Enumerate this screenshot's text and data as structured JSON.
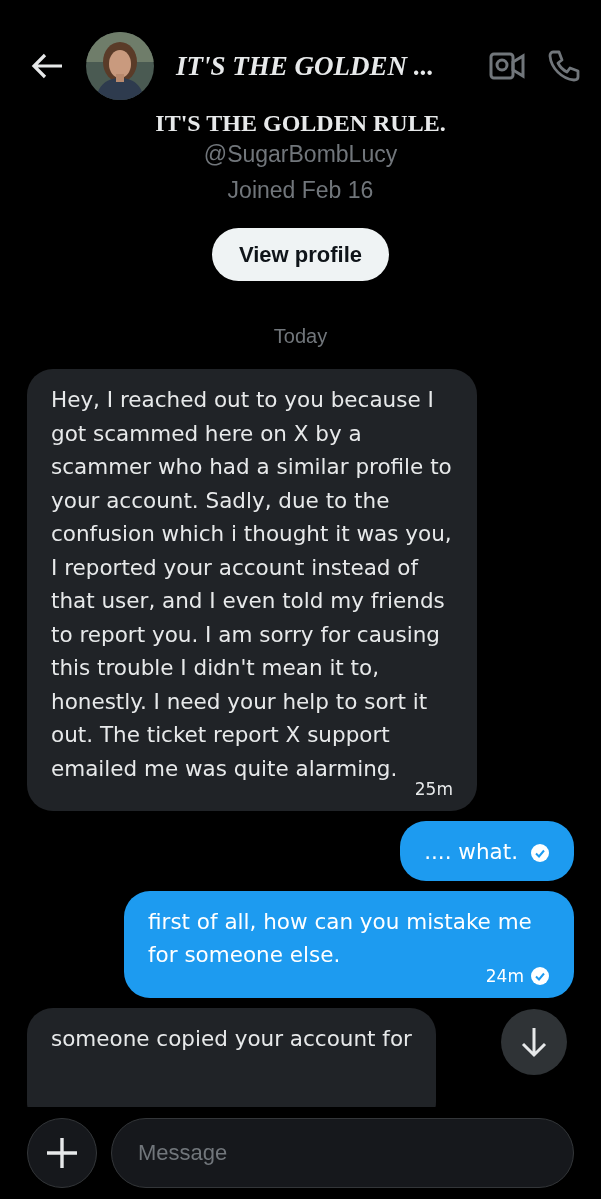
{
  "header": {
    "title": "IT'S THE GOLDEN ..."
  },
  "profile": {
    "display_name": "IT'S THE GOLDEN RULE.",
    "handle": "@SugarBombLucy",
    "joined": "Joined Feb 16",
    "button": "View profile"
  },
  "day_label": "Today",
  "messages": [
    {
      "kind": "received",
      "text": "Hey, I reached out to you because I got scammed here on X by a scammer who had a similar profile to your account. Sadly, due to the confusion which i thought it was you, I reported your account instead of that user, and I even told my friends to report you. I am sorry for causing this trouble I didn't mean it to, honestly. I need your help to sort it out. The ticket report X support emailed me was quite alarming.",
      "time": "25m",
      "read": false
    },
    {
      "kind": "sent",
      "text": ".... what.",
      "read": true
    },
    {
      "kind": "sent",
      "text": "first of all, how can you mistake me for someone else.",
      "time": "24m",
      "read": true
    },
    {
      "kind": "received",
      "text": "someone copied your account for",
      "read": false
    }
  ],
  "composer": {
    "placeholder": "Message"
  }
}
